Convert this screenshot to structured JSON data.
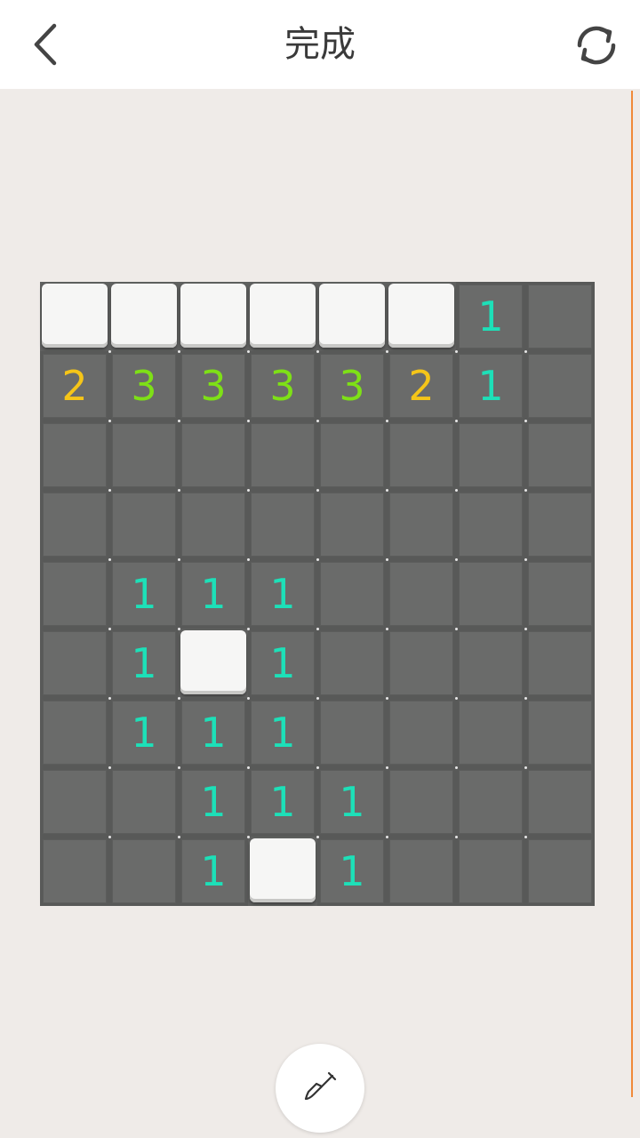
{
  "header": {
    "title": "完成",
    "back_icon": "chevron-left-icon",
    "refresh_icon": "refresh-icon"
  },
  "board": {
    "rows": 9,
    "cols": 8,
    "colors": {
      "1": "#1de0b8",
      "2": "#f5c518",
      "3": "#7ee016"
    },
    "grid": [
      [
        "R",
        "R",
        "R",
        "R",
        "R",
        "R",
        "1",
        ""
      ],
      [
        "2",
        "3",
        "3",
        "3",
        "3",
        "2",
        "1",
        ""
      ],
      [
        "",
        "",
        "",
        "",
        "",
        "",
        "",
        ""
      ],
      [
        "",
        "",
        "",
        "",
        "",
        "",
        "",
        ""
      ],
      [
        "",
        "1",
        "1",
        "1",
        "",
        "",
        "",
        ""
      ],
      [
        "",
        "1",
        "R",
        "1",
        "",
        "",
        "",
        ""
      ],
      [
        "",
        "1",
        "1",
        "1",
        "",
        "",
        "",
        ""
      ],
      [
        "",
        "",
        "1",
        "1",
        "1",
        "",
        "",
        ""
      ],
      [
        "",
        "",
        "1",
        "R",
        "1",
        "",
        "",
        ""
      ]
    ]
  },
  "footer": {
    "tool_icon": "shovel-icon"
  },
  "accent_color": "#f08a3a"
}
